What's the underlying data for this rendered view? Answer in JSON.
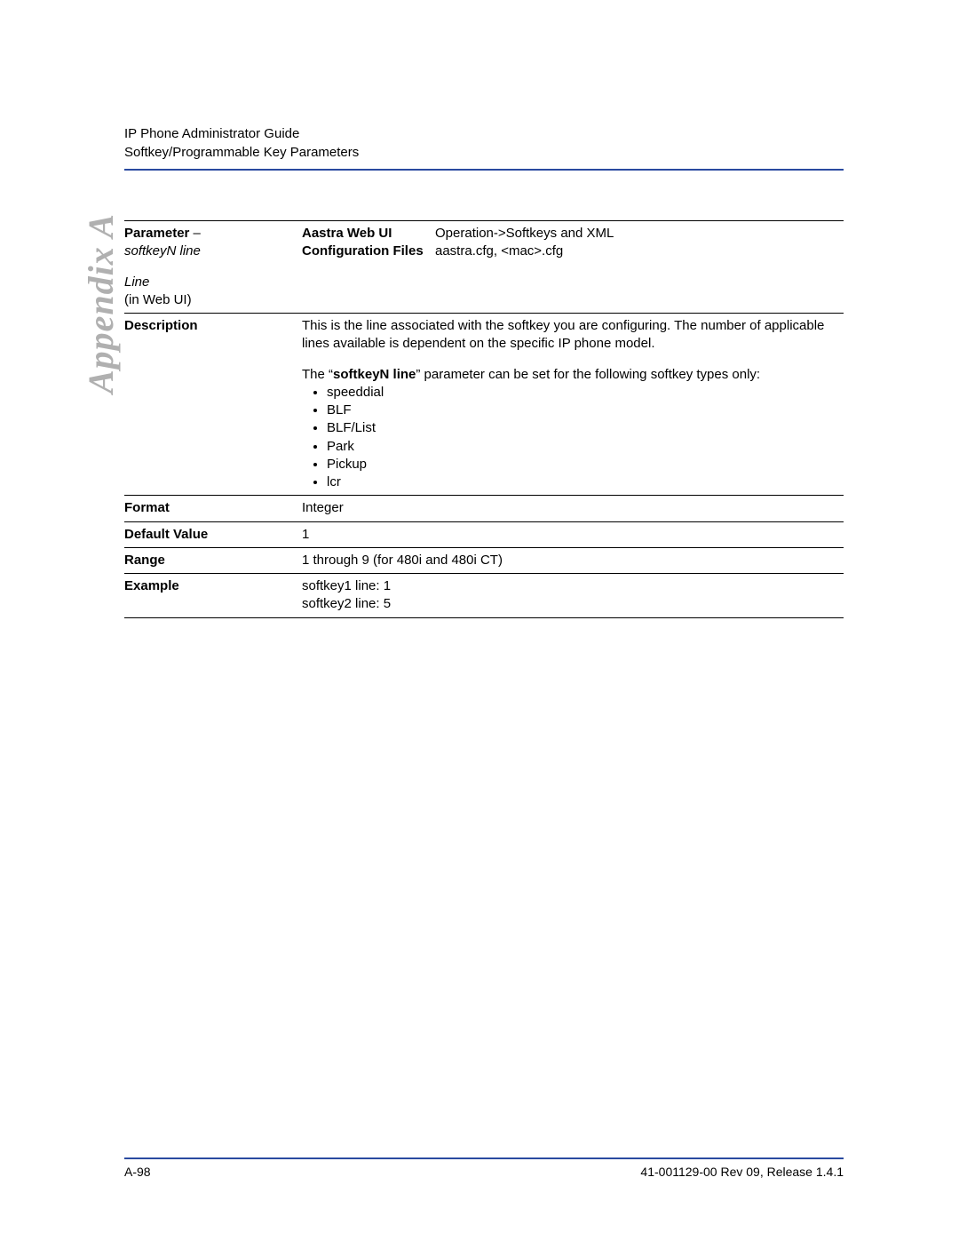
{
  "header": {
    "guide_title": "IP Phone Administrator Guide",
    "section_title": "Softkey/Programmable Key Parameters"
  },
  "side_label": "Appendix A",
  "table": {
    "parameter": {
      "label_prefix": "Parameter",
      "label_dash": " – ",
      "name": "softkeyN line",
      "web_ui_label_1": "Line",
      "web_ui_label_2": "(in Web UI)",
      "web_ui_key": "Aastra Web UI",
      "web_ui_val": "Operation->Softkeys and XML",
      "cfg_key": "Configuration Files",
      "cfg_val": "aastra.cfg, <mac>.cfg"
    },
    "description": {
      "label": "Description",
      "para1": "This is the line associated with the softkey you are configuring. The number of applicable lines available is dependent on the specific IP phone model.",
      "para2_pre": "The “",
      "para2_bold": "softkeyN line",
      "para2_post": "” parameter can be set for the following softkey types only:",
      "bullets": [
        "speeddial",
        "BLF",
        "BLF/List",
        "Park",
        "Pickup",
        "lcr"
      ]
    },
    "format": {
      "label": "Format",
      "value": "Integer"
    },
    "default": {
      "label": "Default Value",
      "value": "1"
    },
    "range": {
      "label": "Range",
      "value": "1 through 9 (for 480i and 480i CT)"
    },
    "example": {
      "label": "Example",
      "value1": "softkey1 line: 1",
      "value2": "softkey2 line: 5"
    }
  },
  "footer": {
    "page": "A-98",
    "rev": "41-001129-00 Rev 09, Release 1.4.1"
  }
}
